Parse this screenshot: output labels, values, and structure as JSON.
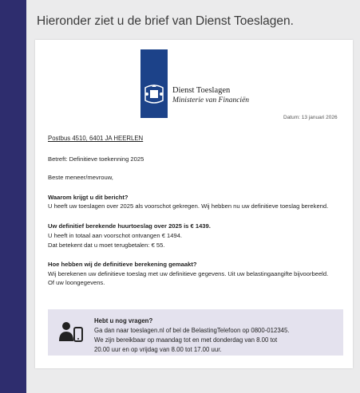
{
  "intro": "Hieronder ziet u de brief van Dienst Toeslagen.",
  "letter": {
    "org_name": "Dienst Toeslagen",
    "ministry": "Ministerie van Financiën",
    "date": "Datum: 13 januari 2026",
    "address": "Postbus 4510, 6401 JA HEERLEN",
    "subject": "Betreft: Definitieve toekenning 2025",
    "salutation": "Beste meneer/mevrouw,",
    "section1": {
      "heading": "Waarom krijgt u dit bericht?",
      "lines": [
        "U heeft uw toeslagen over 2025 als voorschot gekregen. Wij hebben nu uw definitieve toeslag berekend."
      ]
    },
    "section2": {
      "heading": "Uw definitief berekende huurtoeslag over 2025 is € 1439.",
      "lines": [
        "U heeft in totaal aan voorschot ontvangen € 1494.",
        "Dat betekent dat u moet terugbetalen: € 55."
      ]
    },
    "section3": {
      "heading": "Hoe hebben wij de definitieve berekening gemaakt?",
      "lines": [
        "Wij berekenen uw definitieve toeslag met uw definitieve gegevens. Uit uw belastingaangifte bijvoorbeeld.",
        "Of uw loongegevens."
      ]
    },
    "info": {
      "title": "Hebt u nog vragen?",
      "lines": [
        "Ga dan naar toeslagen.nl of bel de BelastingTelefoon op 0800-012345.",
        "We zijn bereikbaar op maandag tot en met donderdag van 8.00 tot",
        "20.00 uur en op vrijdag van 8.00 tot 17.00 uur."
      ]
    }
  }
}
